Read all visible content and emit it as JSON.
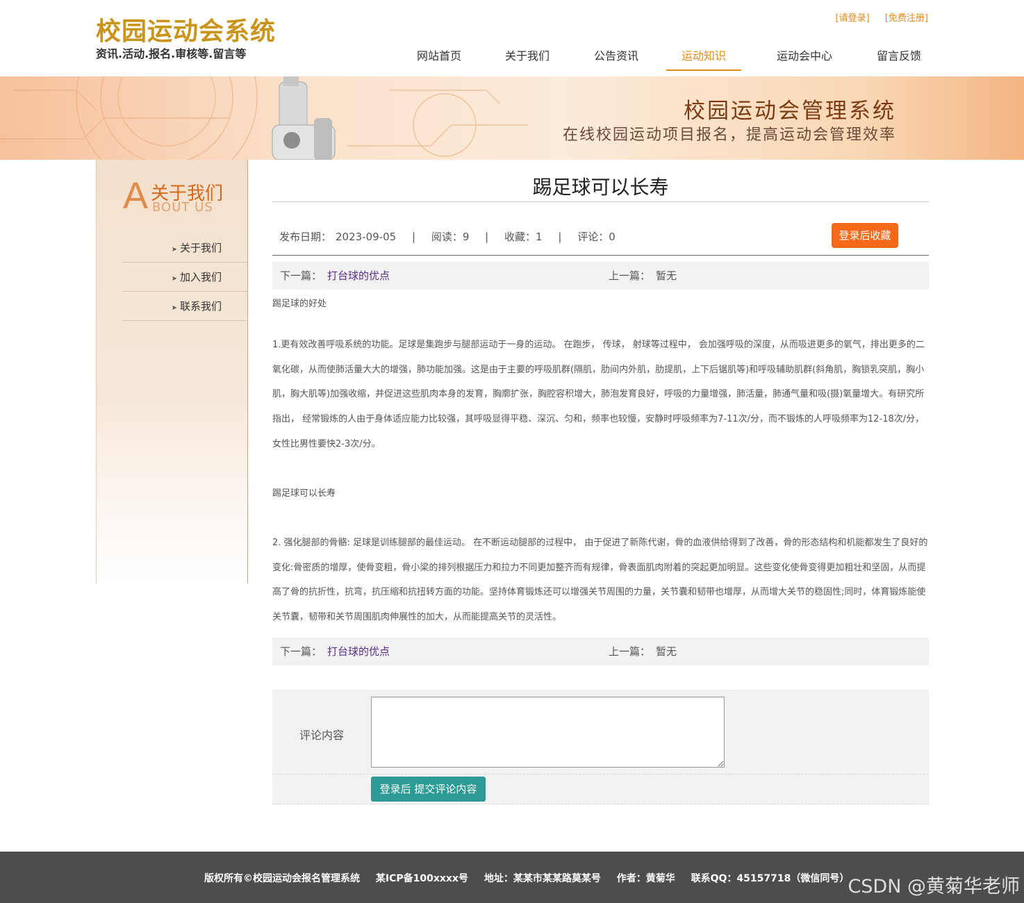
{
  "header": {
    "logo_title": "校园运动会系统",
    "logo_sub": "资讯.活动.报名.审核等.留言等",
    "login_link": "[请登录]",
    "register_link": "[免费注册]",
    "nav": [
      {
        "label": "网站首页"
      },
      {
        "label": "关于我们"
      },
      {
        "label": "公告资讯"
      },
      {
        "label": "运动知识",
        "active": true
      },
      {
        "label": "运动会中心"
      },
      {
        "label": "留言反馈"
      }
    ]
  },
  "banner": {
    "title": "校园运动会管理系统",
    "subtitle": "在线校园运动项目报名，提高运动会管理效率"
  },
  "sidebar": {
    "heading_letter": "A",
    "heading_cn": "关于我们",
    "heading_en": "BOUT US",
    "items": [
      {
        "label": "关于我们"
      },
      {
        "label": "加入我们"
      },
      {
        "label": "联系我们"
      }
    ]
  },
  "article": {
    "title": "踢足球可以长寿",
    "date_label": "发布日期：",
    "date": "2023-09-05",
    "reads_label": "阅读：",
    "reads": "9",
    "favorites_label": "收藏：",
    "favorites": "1",
    "comments_label": "评论：",
    "comments": "0",
    "sep": "|",
    "favorite_button": "登录后收藏",
    "next_label": "下一篇：",
    "next_title": "打台球的优点",
    "prev_label": "上一篇：",
    "prev_title": "暂无",
    "paragraphs": [
      "踢足球的好处",
      "1.更有效改善呼吸系统的功能。足球是集跑步与腿部运动于一身的运动。 在跑步， 传球， 射球等过程中， 会加强呼吸的深度，从而吸进更多的氧气，排出更多的二氧化碳，从而使肺活量大大的增强，肺功能加强。这是由于主要的呼吸肌群(隔肌，肋间内外肌，肋提肌，上下后锯肌等)和呼吸辅助肌群(斜角肌，胸锁乳突肌，胸小肌，胸大肌等)加强收缩，并促进这些肌肉本身的发育，胸廓扩张，胸腔容积增大，肺泡发育良好，呼吸的力量增强，肺活量，肺通气量和吸(摄)氧量增大。有研究所指出， 经常锻炼的人由于身体适应能力比较强，其呼吸显得平稳、深沉、匀和，频率也较慢，安静时呼吸频率为7-11次/分，而不锻炼的人呼吸频率为12-18次/分，女性比男性要快2-3次/分。",
      "踢足球可以长寿",
      "2. 强化腿部的骨骼: 足球是训练腿部的最佳运动。 在不断运动腿部的过程中， 由于促进了新陈代谢，骨的血液供给得到了改善，骨的形态结构和机能都发生了良好的变化:骨密质的增厚，使骨变粗，骨小梁的排列根据压力和拉力不同更加整齐而有规律，骨表面肌肉附着的突起更加明显。这些变化使骨变得更加粗壮和坚固，从而提高了骨的抗折性，抗弯，抗压缩和抗扭转方面的功能。坚持体育锻炼还可以增强关节周围的力量，关节囊和韧带也增厚，从而增大关节的稳固性;同时，体育锻炼能使关节囊，韧带和关节周围肌肉伸展性的加大，从而能提高关节的灵活性。"
    ]
  },
  "comment": {
    "label": "评论内容",
    "textarea_value": "",
    "submit_button": "登录后 提交评论内容"
  },
  "footer": {
    "copyright": "版权所有©校园运动会报名管理系统",
    "icp": "某ICP备100xxxx号",
    "address": "地址：某某市某某路莫某号",
    "author": "作者：黄菊华",
    "qq": "联系QQ：45157718（微信同号）",
    "watermark": "CSDN @黄菊华老师"
  },
  "colors": {
    "brand_gold": "#c8941a",
    "accent_orange": "#e48a1c",
    "favorite_button": "#f7691a",
    "submit_button": "#2d9b95",
    "link_purple": "#5a2d8a",
    "footer_bg": "#4d4d4d"
  }
}
